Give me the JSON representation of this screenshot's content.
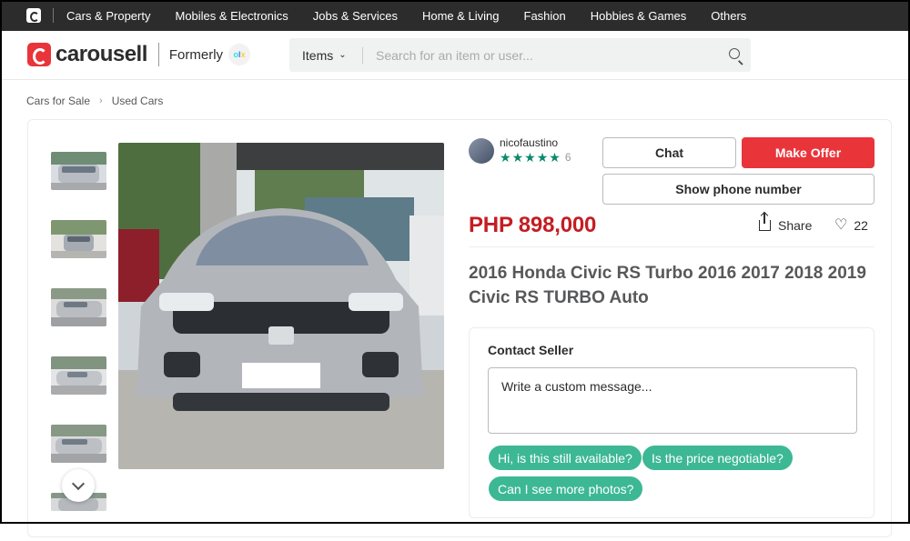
{
  "topbar": {
    "categories": [
      "Cars & Property",
      "Mobiles & Electronics",
      "Jobs & Services",
      "Home & Living",
      "Fashion",
      "Hobbies & Games",
      "Others"
    ]
  },
  "header": {
    "brand": "carousell",
    "formerly": "Formerly",
    "olx": {
      "o": "o",
      "l": "l",
      "x": "x"
    },
    "search": {
      "category": "Items",
      "placeholder": "Search for an item or user..."
    }
  },
  "breadcrumb": [
    "Cars for Sale",
    "Used Cars"
  ],
  "seller": {
    "username": "nicofaustino",
    "rating_stars": 5,
    "review_count": "6"
  },
  "actions": {
    "chat": "Chat",
    "make_offer": "Make Offer",
    "show_phone": "Show phone number"
  },
  "listing": {
    "price": "PHP 898,000",
    "share": "Share",
    "likes": "22",
    "title": "2016 Honda Civic RS Turbo 2016 2017 2018 2019 Civic RS TURBO Auto"
  },
  "contact": {
    "heading": "Contact Seller",
    "placeholder": "Write a custom message...",
    "quick_replies": [
      "Hi, is this still available?",
      "Is the price negotiable?",
      "Can I see more photos?"
    ]
  },
  "colors": {
    "brand_red": "#e9343a",
    "price_red": "#c41d22",
    "chip_green": "#3db894",
    "star_green": "#0b8a6d"
  }
}
